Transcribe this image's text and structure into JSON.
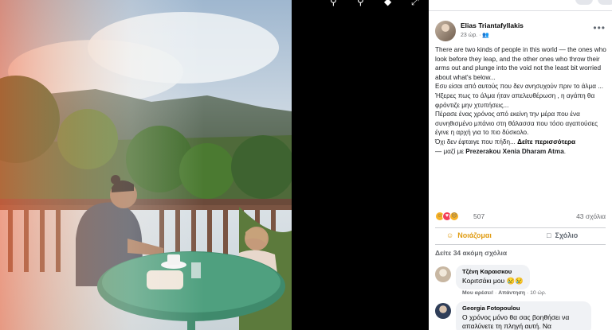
{
  "post": {
    "author": "Elias Triantafyllakis",
    "time": "23 ώρ.",
    "privacy_icon": "people-icon",
    "paragraphs": [
      "There are two kinds of people in this world — the ones who look before they leap, and the other ones who throw their arms out and plunge into the void not the least bit worried about what's below...",
      "Εσυ είσαι από αυτούς που δεν ανησυχούν πριν το άλμα ...",
      "Ήξερες πως το άλμα ήταν απελευθέρωση , η αγάπη θα φρόντιζε μην χτυπήσεις...",
      "Πέρασε ένας χρόνος από εκείνη την μέρα που ένα συνηθισμένο μπάνιο στη θάλασσα που τόσο αγαπούσες έγινε η αρχή για το πιο δύσκολο."
    ],
    "last_line": "Όχι δεν έφταιγε που πήδη...",
    "see_more": "Δείτε περισσότερα",
    "tagged_prefix": "— μαζί με",
    "tagged_name_1": "Prezerakou Xenia",
    "tagged_name_2": "Dharam Atma",
    "tagged_suffix": ".",
    "reaction_count": "507",
    "comment_count": "43 σχόλια",
    "like_label": "Νοιάζομαι",
    "comment_label": "Σχόλιο",
    "view_more_comments": "Δείτε 34 ακόμη σχόλια"
  },
  "comments": [
    {
      "name": "Τζένη Καραισκου",
      "text": "Κοριτσάκι μου 😢😢",
      "like": "Μου αρέσει!",
      "reply": "Απάντηση",
      "time": "10 ώρ."
    },
    {
      "name": "Georgia Fotopoulou",
      "text": "Ο χρόνος μόνο θα σας βοηθήσει να απαλύνετε τη πληγή αυτή. Να"
    }
  ],
  "icons": {
    "viewer_top": [
      "zoom-in-icon",
      "zoom-out-icon",
      "tag-icon",
      "fullscreen-icon"
    ],
    "more": "more-options-icon",
    "like": "care-reaction-icon",
    "comment": "comment-icon"
  },
  "colors": {
    "care_reaction": "#e09c13",
    "panel_bg": "#ffffff",
    "viewer_bg": "#000000"
  }
}
